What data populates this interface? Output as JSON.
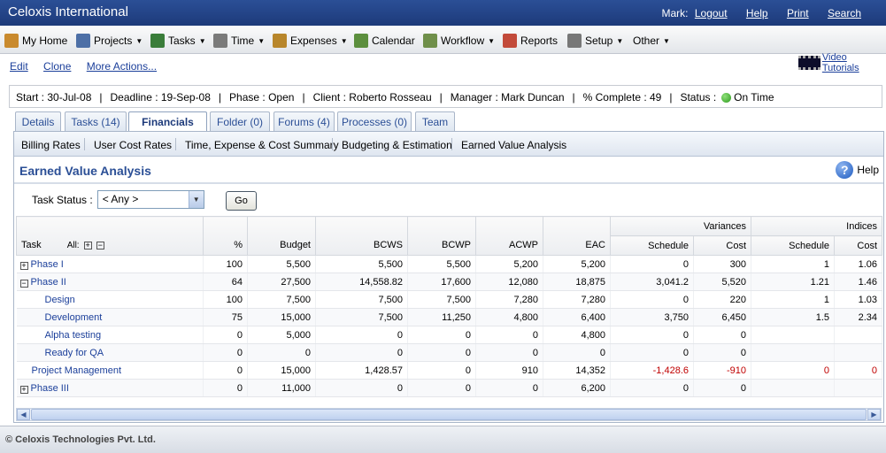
{
  "header": {
    "app_title": "Celoxis International",
    "user": "Mark:",
    "logout": "Logout",
    "help": "Help",
    "print": "Print",
    "search": "Search"
  },
  "menu": [
    {
      "label": "My Home",
      "icon": "home-icon",
      "color": "#c98a2e",
      "dropdown": false
    },
    {
      "label": "Projects",
      "icon": "projects-icon",
      "color": "#4d6fa6",
      "dropdown": true
    },
    {
      "label": "Tasks",
      "icon": "tasks-icon",
      "color": "#3a7d3a",
      "dropdown": true
    },
    {
      "label": "Time",
      "icon": "clock-icon",
      "color": "#7a7a7a",
      "dropdown": true
    },
    {
      "label": "Expenses",
      "icon": "expenses-icon",
      "color": "#b8862b",
      "dropdown": true
    },
    {
      "label": "Calendar",
      "icon": "calendar-icon",
      "color": "#5c8f3e",
      "dropdown": false
    },
    {
      "label": "Workflow",
      "icon": "workflow-icon",
      "color": "#6f8f4a",
      "dropdown": true
    },
    {
      "label": "Reports",
      "icon": "reports-icon",
      "color": "#c24a3a",
      "dropdown": false
    },
    {
      "label": "Setup",
      "icon": "setup-icon",
      "color": "#777777",
      "dropdown": true
    },
    {
      "label": "Other",
      "icon": "",
      "color": "",
      "dropdown": true
    }
  ],
  "actions": {
    "edit": "Edit",
    "clone": "Clone",
    "more": "More Actions...",
    "video": "Video Tutorials"
  },
  "summary": {
    "start": "Start : 30-Jul-08",
    "deadline": "Deadline : 19-Sep-08",
    "phase": "Phase : Open",
    "client": "Client : Roberto Rosseau",
    "manager": "Manager : Mark Duncan",
    "complete": "% Complete : 49",
    "status_label": "Status :",
    "status_value": "On Time",
    "status_color": "#2c9a1c"
  },
  "tabs": [
    {
      "label": "Details",
      "active": false
    },
    {
      "label": "Tasks (14)",
      "active": false
    },
    {
      "label": "Financials",
      "active": true
    },
    {
      "label": "Folder (0)",
      "active": false
    },
    {
      "label": "Forums (4)",
      "active": false
    },
    {
      "label": "Processes (0)",
      "active": false
    },
    {
      "label": "Team",
      "active": false
    }
  ],
  "subtabs": [
    "Billing Rates",
    "User Cost Rates",
    "Time, Expense & Cost Summary",
    "Budgeting & Estimation",
    "Earned Value Analysis"
  ],
  "section": {
    "title": "Earned Value Analysis",
    "help": "Help"
  },
  "filter": {
    "label": "Task Status :",
    "value": "< Any >",
    "go": "Go"
  },
  "table": {
    "headers": {
      "task": "Task",
      "all": "All:",
      "pct": "%",
      "budget": "Budget",
      "bcws": "BCWS",
      "bcwp": "BCWP",
      "acwp": "ACWP",
      "eac": "EAC",
      "variances": "Variances",
      "indices": "Indices",
      "schedule": "Schedule",
      "cost": "Cost"
    },
    "rows": [
      {
        "task": "Phase I",
        "level": 0,
        "toggle": "+",
        "pct": "100",
        "budget": "5,500",
        "bcws": "5,500",
        "bcwp": "5,500",
        "acwp": "5,200",
        "eac": "5,200",
        "var_sched": "0",
        "var_cost": "300",
        "idx_sched": "1",
        "idx_cost": "1.06",
        "neg": false
      },
      {
        "task": "Phase II",
        "level": 0,
        "toggle": "−",
        "pct": "64",
        "budget": "27,500",
        "bcws": "14,558.82",
        "bcwp": "17,600",
        "acwp": "12,080",
        "eac": "18,875",
        "var_sched": "3,041.2",
        "var_cost": "5,520",
        "idx_sched": "1.21",
        "idx_cost": "1.46",
        "neg": false
      },
      {
        "task": "Design",
        "level": 2,
        "toggle": "",
        "pct": "100",
        "budget": "7,500",
        "bcws": "7,500",
        "bcwp": "7,500",
        "acwp": "7,280",
        "eac": "7,280",
        "var_sched": "0",
        "var_cost": "220",
        "idx_sched": "1",
        "idx_cost": "1.03",
        "neg": false
      },
      {
        "task": "Development",
        "level": 2,
        "toggle": "",
        "pct": "75",
        "budget": "15,000",
        "bcws": "7,500",
        "bcwp": "11,250",
        "acwp": "4,800",
        "eac": "6,400",
        "var_sched": "3,750",
        "var_cost": "6,450",
        "idx_sched": "1.5",
        "idx_cost": "2.34",
        "neg": false
      },
      {
        "task": "Alpha testing",
        "level": 2,
        "toggle": "",
        "pct": "0",
        "budget": "5,000",
        "bcws": "0",
        "bcwp": "0",
        "acwp": "0",
        "eac": "4,800",
        "var_sched": "0",
        "var_cost": "0",
        "idx_sched": "",
        "idx_cost": "",
        "neg": false
      },
      {
        "task": "Ready for QA",
        "level": 2,
        "toggle": "",
        "pct": "0",
        "budget": "0",
        "bcws": "0",
        "bcwp": "0",
        "acwp": "0",
        "eac": "0",
        "var_sched": "0",
        "var_cost": "0",
        "idx_sched": "",
        "idx_cost": "",
        "neg": false
      },
      {
        "task": "Project Management",
        "level": 1,
        "toggle": "",
        "pct": "0",
        "budget": "15,000",
        "bcws": "1,428.57",
        "bcwp": "0",
        "acwp": "910",
        "eac": "14,352",
        "var_sched": "-1,428.6",
        "var_cost": "-910",
        "idx_sched": "0",
        "idx_cost": "0",
        "neg": true
      },
      {
        "task": "Phase III",
        "level": 0,
        "toggle": "+",
        "pct": "0",
        "budget": "11,000",
        "bcws": "0",
        "bcwp": "0",
        "acwp": "0",
        "eac": "6,200",
        "var_sched": "0",
        "var_cost": "0",
        "idx_sched": "",
        "idx_cost": "",
        "neg": false
      }
    ]
  },
  "footer": "© Celoxis Technologies Pvt. Ltd."
}
